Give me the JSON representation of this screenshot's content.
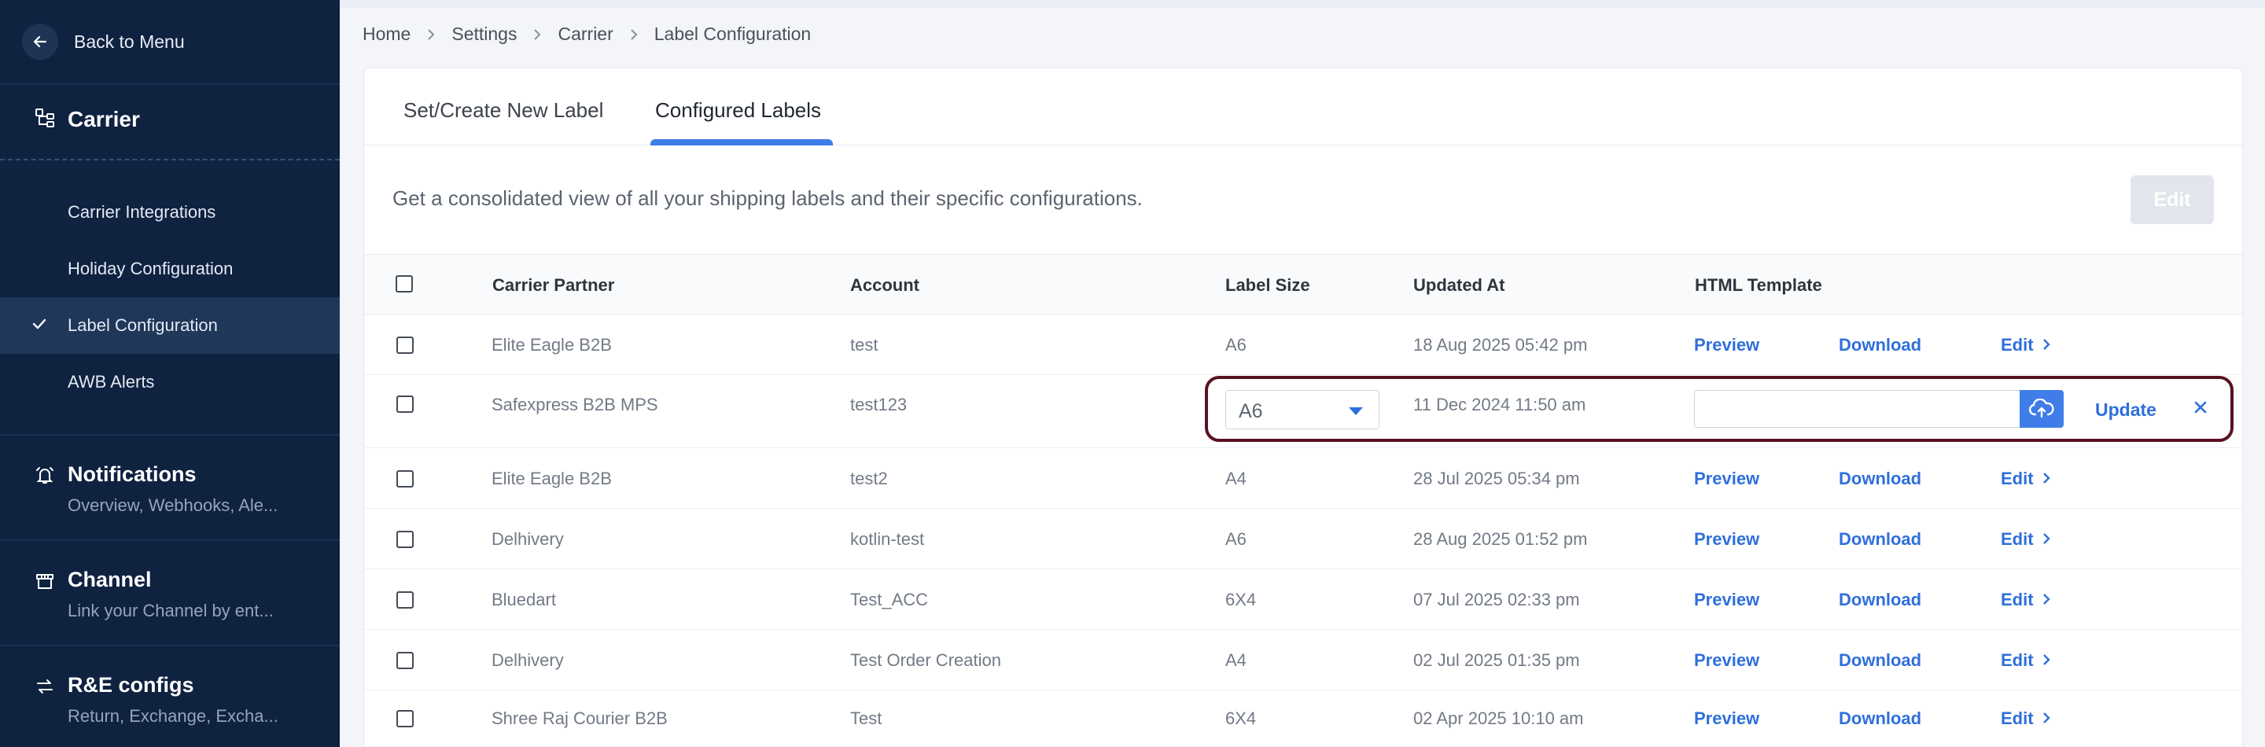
{
  "sidebar": {
    "back_label": "Back to Menu",
    "section_title": "Carrier",
    "items": [
      {
        "label": "Carrier Integrations",
        "active": false
      },
      {
        "label": "Holiday Configuration",
        "active": false
      },
      {
        "label": "Label Configuration",
        "active": true
      },
      {
        "label": "AWB Alerts",
        "active": false
      }
    ],
    "groups": [
      {
        "title": "Notifications",
        "subtitle": "Overview, Webhooks, Ale...",
        "icon": "bell-icon"
      },
      {
        "title": "Channel",
        "subtitle": "Link your Channel by ent...",
        "icon": "store-icon"
      },
      {
        "title": "R&E configs",
        "subtitle": "Return, Exchange, Excha...",
        "icon": "exchange-icon"
      }
    ]
  },
  "breadcrumb": [
    "Home",
    "Settings",
    "Carrier",
    "Label Configuration"
  ],
  "tabs": [
    "Set/Create New Label",
    "Configured Labels"
  ],
  "active_tab": "Configured Labels",
  "description": "Get a consolidated view of all your shipping labels and their specific configurations.",
  "edit_button": "Edit",
  "table": {
    "headers": [
      "Carrier Partner",
      "Account",
      "Label Size",
      "Updated At",
      "HTML Template"
    ],
    "action_labels": {
      "preview": "Preview",
      "download": "Download",
      "edit": "Edit",
      "update": "Update"
    },
    "rows": [
      {
        "carrier": "Elite Eagle B2B",
        "account": "test",
        "size": "A6",
        "updated": "18 Aug 2025 05:42 pm"
      },
      {
        "carrier": "Safexpress B2B MPS",
        "account": "test123",
        "size": "A6",
        "updated": "11 Dec 2024 11:50 am",
        "editing": true
      },
      {
        "carrier": "Elite Eagle B2B",
        "account": "test2",
        "size": "A4",
        "updated": "28 Jul 2025 05:34 pm"
      },
      {
        "carrier": "Delhivery",
        "account": "kotlin-test",
        "size": "A6",
        "updated": "28 Aug 2025 01:52 pm"
      },
      {
        "carrier": "Bluedart",
        "account": "Test_ACC",
        "size": "6X4",
        "updated": "07 Jul 2025 02:33 pm"
      },
      {
        "carrier": "Delhivery",
        "account": "Test Order Creation",
        "size": "A4",
        "updated": "02 Jul 2025 01:35 pm"
      },
      {
        "carrier": "Shree Raj Courier B2B",
        "account": "Test",
        "size": "6X4",
        "updated": "02 Apr 2025 10:10 am"
      }
    ]
  },
  "colors": {
    "sidebar_bg": "#0f2240",
    "accent": "#3f7de8",
    "link": "#2f6fdb",
    "edit_row_border": "#5a1220"
  }
}
